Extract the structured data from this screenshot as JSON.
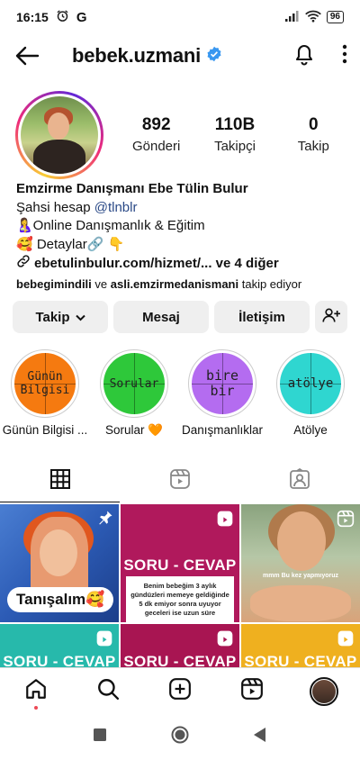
{
  "status_bar": {
    "time": "16:15",
    "battery": "96"
  },
  "header": {
    "username": "bebek.uzmani"
  },
  "stats": [
    {
      "value": "892",
      "label": "Gönderi"
    },
    {
      "value": "110B",
      "label": "Takipçi"
    },
    {
      "value": "0",
      "label": "Takip"
    }
  ],
  "bio": {
    "name": "Emzirme Danışmanı Ebe Tülin Bulur",
    "line1_prefix": "Şahsi hesap ",
    "line1_mention": "@tlnblr",
    "line2": "🤱Online Danışmanlık & Eğitim",
    "line3": "🥰 Detaylar🔗 👇",
    "link": "ebetulinbulur.com/hizmet/... ve 4 diğer",
    "followed_user1": "bebegimindili",
    "followed_connector": " ve ",
    "followed_user2": "asli.emzirmedanismani",
    "followed_suffix": " takip ediyor"
  },
  "buttons": {
    "follow": "Takip",
    "message": "Mesaj",
    "contact": "İletişim"
  },
  "highlights": [
    {
      "cover_text": "Günün Bilgisi",
      "label": "Günün Bilgisi ...",
      "color": "#f57a10"
    },
    {
      "cover_text": "Sorular",
      "label": "Sorular 🧡",
      "color": "#2ec83a"
    },
    {
      "cover_text": "bire bir",
      "label": "Danışmanlıklar",
      "color": "#b46cf0"
    },
    {
      "cover_text": "atölye",
      "label": "Atölye",
      "color": "#2fd6d0"
    }
  ],
  "posts": {
    "p1_tag": "Tanışalım🥰",
    "p2_title": "SORU - CEVAP",
    "p2_question": "Benim bebeğim 3 aylık gündüzleri memeye geldiğinde 5 dk emiyor sonra uyuyor geceleri ise uzun süre",
    "p3_caption": "mmm Bu kez yapmıyoruz",
    "p4_title": "SORU - CEVAP",
    "p5_title": "SORU - CEVAP",
    "p6_title": "SORU - CEVAP"
  }
}
